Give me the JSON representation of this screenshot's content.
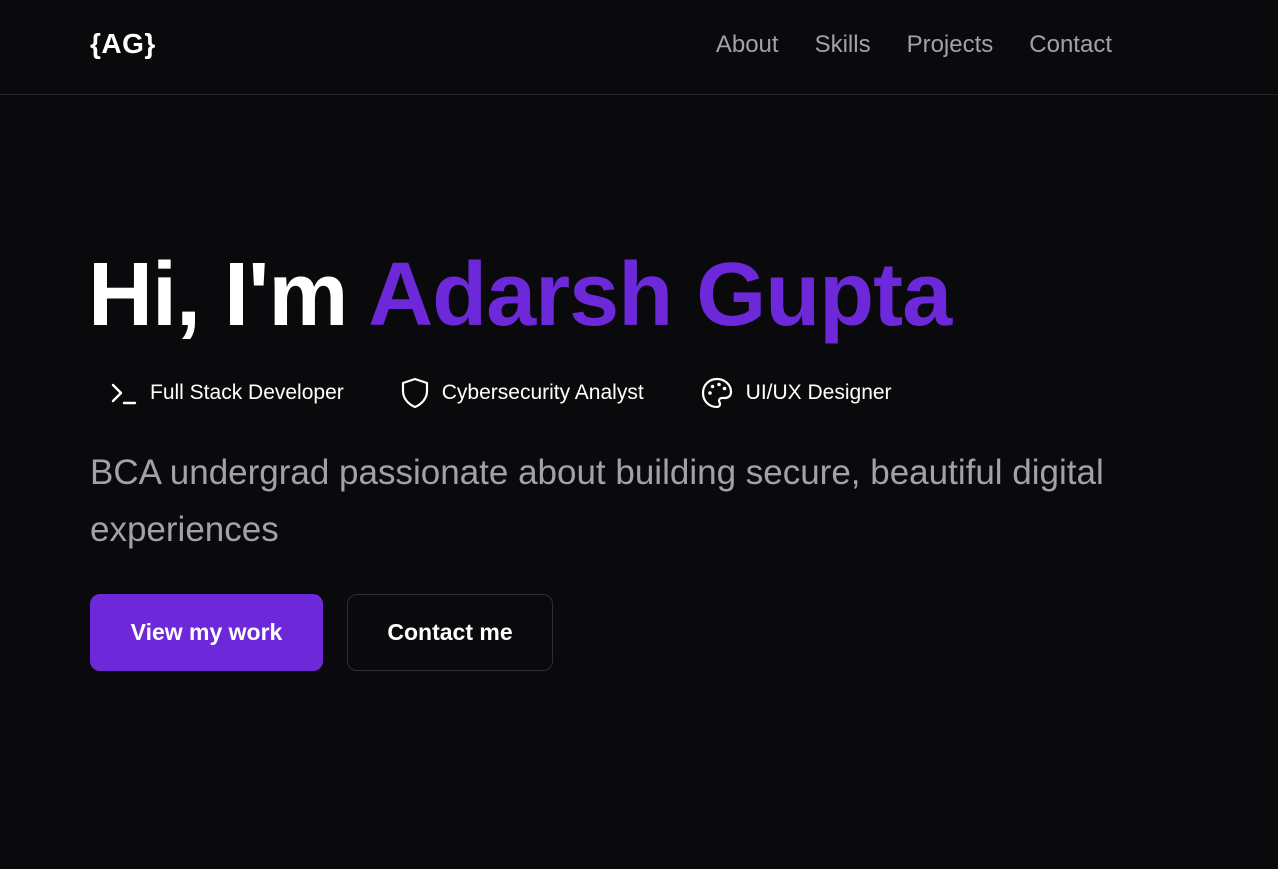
{
  "nav": {
    "logo": "{AG}",
    "links": [
      "About",
      "Skills",
      "Projects",
      "Contact"
    ]
  },
  "hero": {
    "greeting": "Hi, I'm ",
    "name": "Adarsh Gupta",
    "roles": [
      {
        "label": "Full Stack Developer",
        "icon": "terminal-icon"
      },
      {
        "label": "Cybersecurity Analyst",
        "icon": "shield-icon"
      },
      {
        "label": "UI/UX Designer",
        "icon": "palette-icon"
      }
    ],
    "tagline": "BCA undergrad passionate about building secure, beautiful digital experiences",
    "primary_button": "View my work",
    "secondary_button": "Contact me"
  },
  "colors": {
    "background": "#0a0a0c",
    "accent": "#6d28d9",
    "muted_text": "#a1a1aa",
    "border": "#26262b"
  }
}
